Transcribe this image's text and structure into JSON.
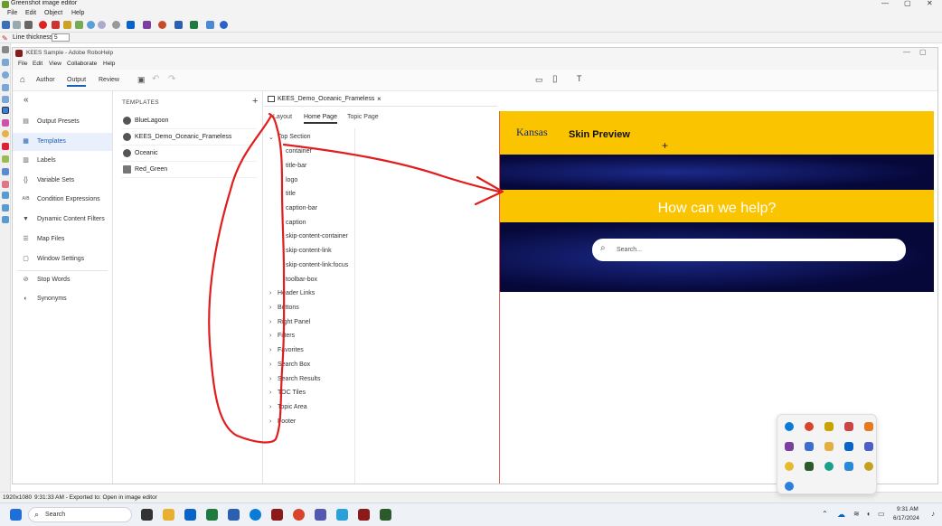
{
  "greenshot": {
    "title": "Greenshot image editor",
    "menu": [
      "File",
      "Edit",
      "Object",
      "Help"
    ],
    "line_thickness_label": "Line thickness",
    "line_thickness_value": "5",
    "status_size": "1920x1080",
    "status_message": "9:31:33 AM - Exported to: Open in image editor"
  },
  "robohelp": {
    "title": "KEES Sample - Adobe RoboHelp",
    "menu": [
      "File",
      "Edit",
      "View",
      "Collaborate",
      "Help"
    ],
    "tabs": [
      "Author",
      "Output",
      "Review"
    ],
    "nav": [
      {
        "label": "Output Presets",
        "icon": "output-presets-icon"
      },
      {
        "label": "Templates",
        "icon": "templates-icon"
      },
      {
        "label": "Labels",
        "icon": "labels-icon"
      },
      {
        "label": "Variable Sets",
        "icon": "variable-sets-icon"
      },
      {
        "label": "Condition Expressions",
        "icon": "condition-icon"
      },
      {
        "label": "Dynamic Content Filters",
        "icon": "filter-icon"
      },
      {
        "label": "Map Files",
        "icon": "map-files-icon"
      },
      {
        "label": "Window Settings",
        "icon": "window-settings-icon"
      },
      {
        "label": "Stop Words",
        "icon": "stop-words-icon"
      },
      {
        "label": "Synonyms",
        "icon": "synonyms-icon"
      }
    ],
    "templates_heading": "TEMPLATES",
    "templates": [
      "BlueLagoon",
      "KEES_Demo_Oceanic_Frameless",
      "Oceanic",
      "Red_Green"
    ],
    "editor_tab": "KEES_Demo_Oceanic_Frameless",
    "subtabs": [
      "Layout",
      "Home Page",
      "Topic Page"
    ],
    "tree_expanded": "Top Section",
    "tree_children": [
      "container",
      "title-bar",
      "logo",
      "title",
      "caption-bar",
      "caption",
      "skip-content-container",
      "skip-content-link",
      "skip-content-link:focus",
      "toolbar-box"
    ],
    "tree_collapsed": [
      "Header Links",
      "Buttons",
      "Right Panel",
      "Filters",
      "Favorites",
      "Search Box",
      "Search Results",
      "TOC Tiles",
      "Topic Area",
      "Footer"
    ],
    "preview": {
      "logo_text": "Kansas",
      "title": "Skin Preview",
      "help_text": "How can we help?",
      "search_placeholder": "Search...",
      "colors": {
        "yellow": "#fbc400",
        "navy": "#06083a"
      }
    }
  },
  "taskbar": {
    "search_placeholder": "Search",
    "time": "9:31 AM",
    "date": "6/17/2024"
  }
}
